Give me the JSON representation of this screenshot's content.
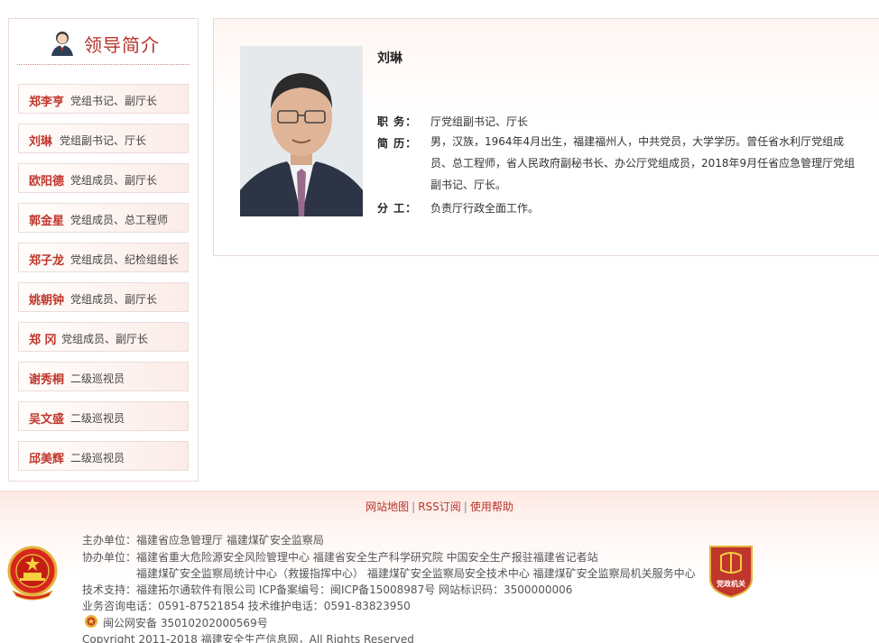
{
  "sidebar": {
    "title": "领导简介",
    "items": [
      {
        "name": "郑李亨",
        "title": "党组书记、副厅长"
      },
      {
        "name": "刘琳",
        "title": "党组副书记、厅长"
      },
      {
        "name": "欧阳德",
        "title": "党组成员、副厅长"
      },
      {
        "name": "郭金星",
        "title": "党组成员、总工程师"
      },
      {
        "name": "郑子龙",
        "title": "党组成员、纪检组组长"
      },
      {
        "name": "姚朝钟",
        "title": "党组成员、副厅长"
      },
      {
        "name": "郑 冈",
        "title": "党组成员、副厅长"
      },
      {
        "name": "谢秀桐",
        "title": "二级巡视员"
      },
      {
        "name": "吴文盛",
        "title": "二级巡视员"
      },
      {
        "name": "邱美辉",
        "title": "二级巡视员"
      }
    ]
  },
  "profile": {
    "name": "刘琳",
    "position_label": "职 务：",
    "position_value": "厅党组副书记、厅长",
    "bio_label": "简 历：",
    "bio_value": "男，汉族，1964年4月出生，福建福州人，中共党员，大学学历。曾任省水利厅党组成员、总工程师，省人民政府副秘书长、办公厅党组成员，2018年9月任省应急管理厅党组副书记、厅长。",
    "duty_label": "分 工：",
    "duty_value": "负责厅行政全面工作。"
  },
  "footer": {
    "links": [
      "网站地图",
      "RSS订阅",
      "使用帮助"
    ],
    "sponsor": "主办单位：福建省应急管理厅 福建煤矿安全监察局",
    "coorg_1": "协办单位：福建省重大危险源安全风险管理中心 福建省安全生产科学研究院 中国安全生产报驻福建省记者站",
    "coorg_2": "福建煤矿安全监察局统计中心（救援指挥中心） 福建煤矿安全监察局安全技术中心 福建煤矿安全监察局机关服务中心",
    "tech": "技术支持：福建拓尔通软件有限公司  ICP备案编号：闽ICP备15008987号  网站标识码：3500000006",
    "phone": "业务咨询电话：0591-87521854 技术维护电话：0591-83823950",
    "police": "闽公网安备 35010202000569号",
    "copyright": "Copyright 2011-2018 福建安全生产信息网，All Rights Reserved",
    "badge_text": "党政机关"
  },
  "colors": {
    "accent": "#b6322b",
    "name_red": "#c0362c"
  }
}
